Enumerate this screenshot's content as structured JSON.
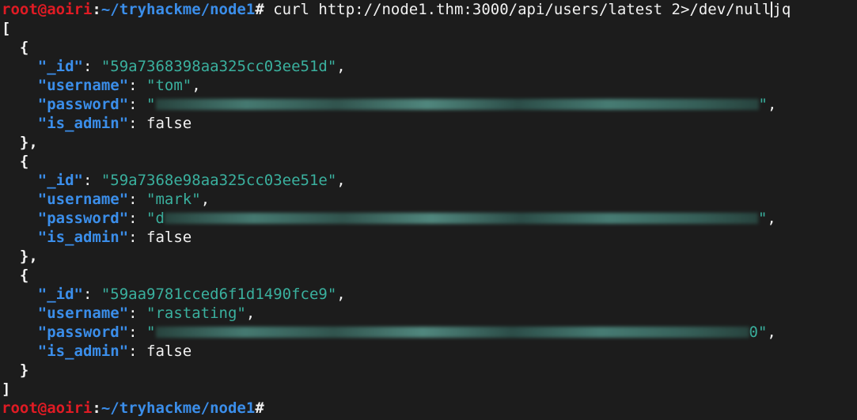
{
  "colors": {
    "background": "#1c1c1c",
    "prompt_user": "#e01b24",
    "prompt_path": "#3b8eea",
    "json_key": "#3b8eea",
    "json_string": "#3ab09e",
    "foreground": "#f2f2f2"
  },
  "prompt": {
    "user_host": "root@aoiri",
    "colon": ":",
    "path": "~/tryhackme/node1",
    "symbol": "#"
  },
  "command": {
    "text": "curl http://node1.thm:3000/api/users/latest 2>/dev/null",
    "pipe": "jq"
  },
  "output": {
    "open_array": "[",
    "close_array": "]",
    "open_object": "{",
    "close_object": "},",
    "close_object_last": "}",
    "keys": {
      "id": "\"_id\"",
      "username": "\"username\"",
      "password": "\"password\"",
      "is_admin": "\"is_admin\""
    },
    "users": [
      {
        "id": "\"59a7368398aa325cc03ee51d\"",
        "username": "\"tom\"",
        "password_prefix": "\"",
        "password_suffix": "\"",
        "is_admin": "false"
      },
      {
        "id": "\"59a7368e98aa325cc03ee51e\"",
        "username": "\"mark\"",
        "password_prefix": "\"d",
        "password_suffix": "\"",
        "is_admin": "false"
      },
      {
        "id": "\"59aa9781cced6f1d1490fce9\"",
        "username": "\"rastating\"",
        "password_prefix": "\"",
        "password_suffix": "0\"",
        "is_admin": "false"
      }
    ]
  }
}
